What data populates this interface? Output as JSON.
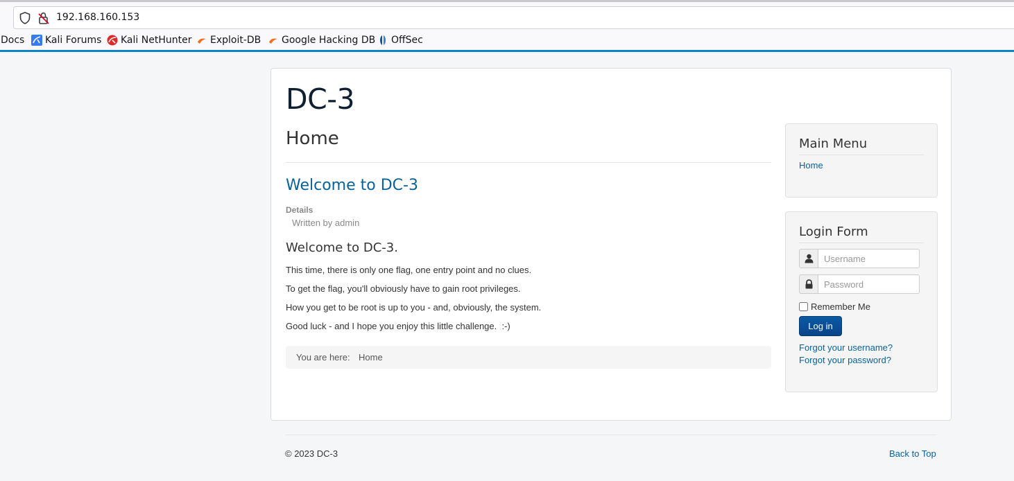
{
  "browser": {
    "url": "192.168.160.153",
    "bookmarks": [
      {
        "label": "Docs",
        "icon": "none"
      },
      {
        "label": "Kali Forums",
        "icon": "kali-forums-icon"
      },
      {
        "label": "Kali NetHunter",
        "icon": "kali-nethunter-icon"
      },
      {
        "label": "Exploit-DB",
        "icon": "exploit-db-icon"
      },
      {
        "label": "Google Hacking DB",
        "icon": "ghdb-icon"
      },
      {
        "label": "OffSec",
        "icon": "offsec-icon"
      }
    ]
  },
  "site": {
    "title": "DC-3"
  },
  "main": {
    "page_heading": "Home",
    "article": {
      "title": "Welcome to DC-3",
      "details_label": "Details",
      "written_by": "Written by admin",
      "heading": "Welcome to DC-3.",
      "paragraphs": [
        "This time, there is only one flag, one entry point and no clues.",
        "To get the flag, you'll obviously have to gain root privileges.",
        "How you get to be root is up to you - and, obviously, the system.",
        "Good luck - and I hope you enjoy this little challenge.  :-)"
      ]
    },
    "breadcrumb": {
      "label": "You are here:",
      "item": "Home"
    }
  },
  "sidebar": {
    "main_menu": {
      "title": "Main Menu",
      "items": [
        "Home"
      ]
    },
    "login_form": {
      "title": "Login Form",
      "username_placeholder": "Username",
      "password_placeholder": "Password",
      "remember_label": "Remember Me",
      "login_button": "Log in",
      "forgot_username": "Forgot your username?",
      "forgot_password": "Forgot your password?"
    }
  },
  "footer": {
    "copyright": "© 2023 DC-3",
    "back_to_top": "Back to Top"
  },
  "colors": {
    "link": "#08629a",
    "button": "#08438a",
    "accent_bar": "#0a84c6"
  }
}
